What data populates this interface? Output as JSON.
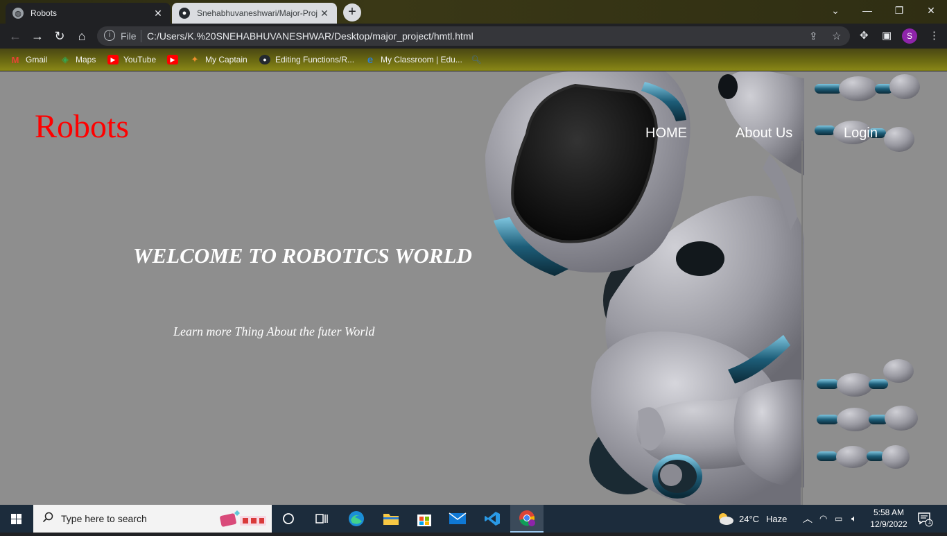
{
  "browser": {
    "tabs": [
      {
        "title": "Robots",
        "active": true,
        "icon": "globe-icon"
      },
      {
        "title": "Snehabhuvaneshwari/Major-Proj",
        "active": false,
        "icon": "github-icon"
      }
    ],
    "new_tab_label": "+",
    "omnibox": {
      "scheme_label": "File",
      "url": "C:/Users/K.%20SNEHABHUVANESHWAR/Desktop/major_project/hmtl.html"
    },
    "profile_initial": "S",
    "bookmarks": [
      {
        "label": "Gmail",
        "icon": "gmail-icon"
      },
      {
        "label": "Maps",
        "icon": "maps-icon"
      },
      {
        "label": "YouTube",
        "icon": "youtube-icon"
      },
      {
        "label": "",
        "icon": "youtube-icon"
      },
      {
        "label": "My Captain",
        "icon": "mycaptain-icon"
      },
      {
        "label": "Editing Functions/R...",
        "icon": "github-icon"
      },
      {
        "label": "My Classroom | Edu...",
        "icon": "edu-icon"
      },
      {
        "label": "",
        "icon": "search-icon"
      }
    ]
  },
  "page": {
    "logo": "Robots",
    "nav": {
      "home": "HOME",
      "about": "About Us",
      "login": "Login"
    },
    "hero_title": "WELCOME TO ROBOTICS WORLD",
    "hero_subtitle": "Learn more Thing About the futer World",
    "colors": {
      "background": "#8e8e8e",
      "logo": "#ff0000",
      "text": "#ffffff"
    }
  },
  "taskbar": {
    "search_placeholder": "Type here to search",
    "weather": {
      "temp": "24°C",
      "condition": "Haze"
    },
    "clock": {
      "time": "5:58 AM",
      "date": "12/9/2022"
    },
    "notification_count": "1"
  }
}
